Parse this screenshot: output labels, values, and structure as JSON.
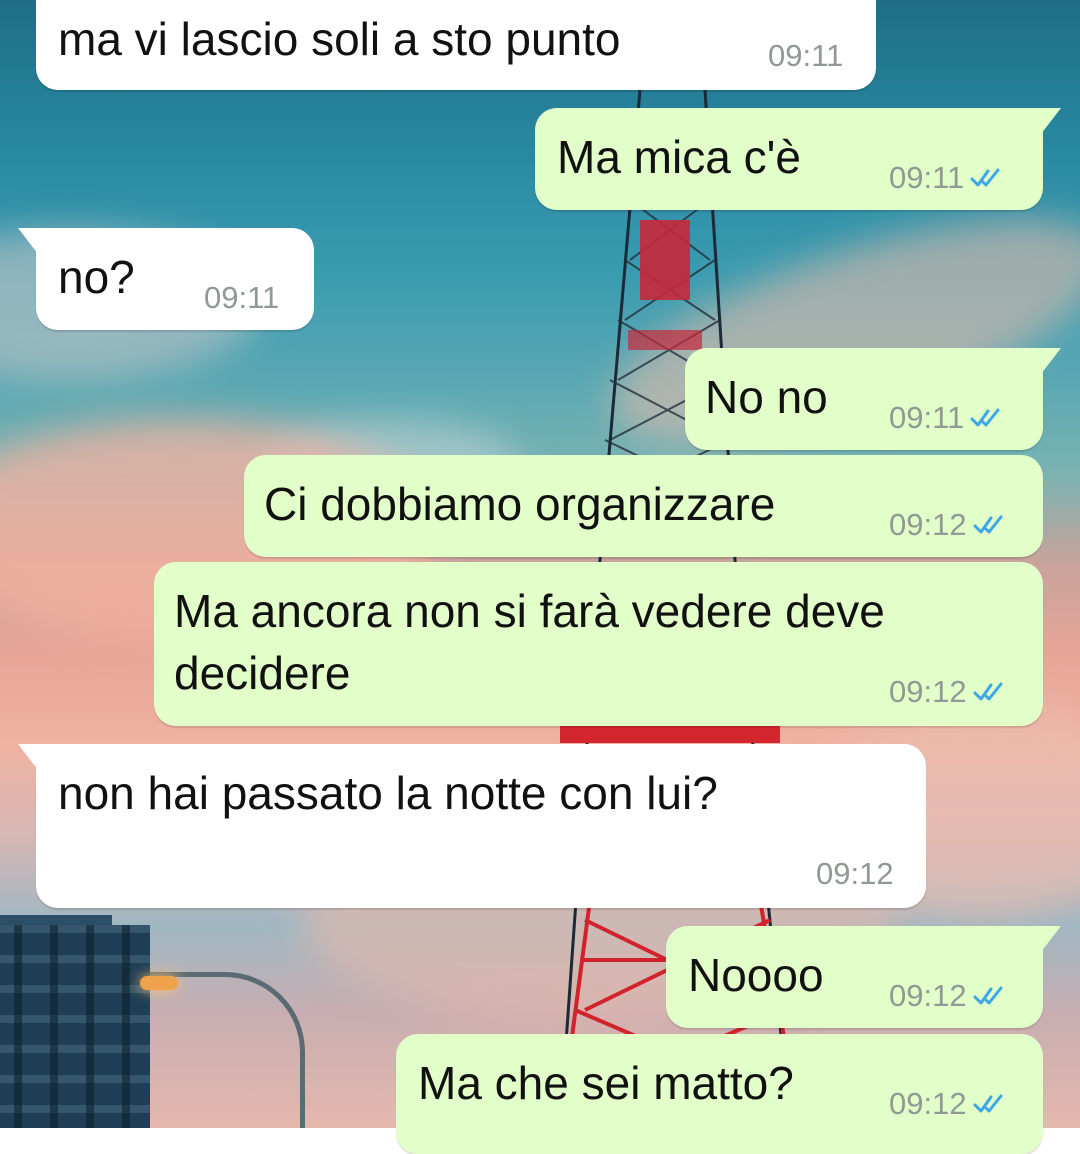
{
  "colors": {
    "incoming_bubble": "#ffffff",
    "outgoing_bubble": "#e2fec9",
    "read_ticks": "#3aa8e6",
    "timestamp": "#8f9a94"
  },
  "messages": [
    {
      "dir": "in",
      "text": "ma vi lascio soli a sto punto",
      "time": "09:11",
      "status": ""
    },
    {
      "dir": "out",
      "text": "Ma mica c'è",
      "time": "09:11",
      "status": "read"
    },
    {
      "dir": "in",
      "text": "no?",
      "time": "09:11",
      "status": ""
    },
    {
      "dir": "out",
      "text": "No no",
      "time": "09:11",
      "status": "read"
    },
    {
      "dir": "out",
      "text": "Ci dobbiamo organizzare",
      "time": "09:12",
      "status": "read"
    },
    {
      "dir": "out",
      "text": "Ma ancora non si farà vedere deve decidere",
      "time": "09:12",
      "status": "read"
    },
    {
      "dir": "in",
      "text": "non hai passato la notte con lui?",
      "time": "09:12",
      "status": ""
    },
    {
      "dir": "out",
      "text": "Noooo",
      "time": "09:12",
      "status": "read"
    },
    {
      "dir": "out",
      "text": "Ma che sei matto?",
      "time": "09:12",
      "status": "read"
    }
  ]
}
